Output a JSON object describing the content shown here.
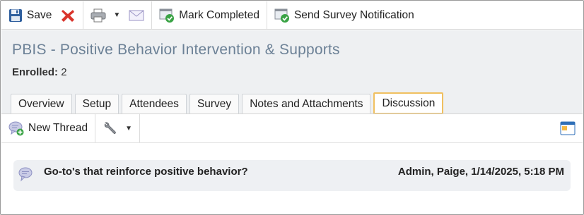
{
  "toolbar": {
    "save_label": "Save",
    "mark_completed_label": "Mark Completed",
    "send_survey_label": "Send Survey Notification"
  },
  "header": {
    "title": "PBIS - Positive Behavior Intervention & Supports",
    "enrolled_label": "Enrolled:",
    "enrolled_count": "2"
  },
  "tabs": [
    {
      "label": "Overview"
    },
    {
      "label": "Setup"
    },
    {
      "label": "Attendees"
    },
    {
      "label": "Survey"
    },
    {
      "label": "Notes and Attachments"
    },
    {
      "label": "Discussion",
      "active": true
    }
  ],
  "discussion": {
    "new_thread_label": "New Thread",
    "threads": [
      {
        "subject": "Go-to's that reinforce positive behavior?",
        "meta": "Admin, Paige, 1/14/2025, 5:18 PM"
      }
    ]
  },
  "icons": {
    "save": "floppy-disk-icon",
    "delete": "red-x-icon",
    "print": "printer-icon",
    "email": "envelope-icon",
    "mark_completed": "checkmark-window-icon",
    "send_survey": "checkmark-window-icon",
    "new_thread": "speech-bubble-plus-icon",
    "tools": "wrench-icon",
    "popout": "window-icon",
    "thread": "speech-bubble-icon"
  },
  "colors": {
    "title": "#6c8196",
    "active_tab_border": "#f0c060",
    "header_bg": "#eef0f2",
    "thread_bg": "#eef0f3",
    "delete_red": "#d9342b",
    "check_green": "#3aa345"
  }
}
